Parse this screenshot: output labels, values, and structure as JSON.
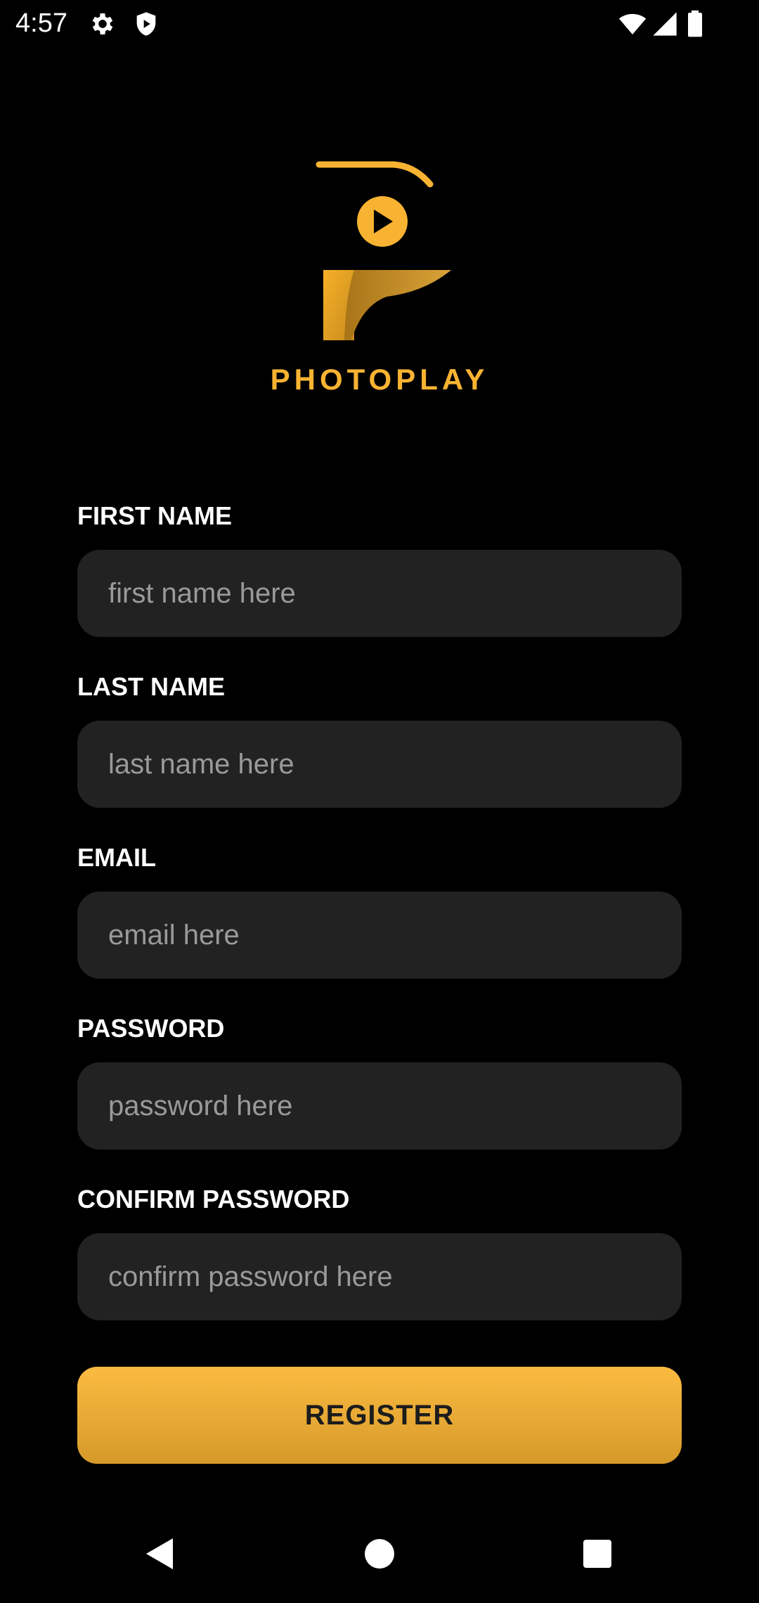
{
  "status_bar": {
    "time": "4:57",
    "icons_left": [
      "gear-icon",
      "shield-icon"
    ],
    "icons_right": [
      "wifi-icon",
      "cellular-signal-icon",
      "battery-icon"
    ]
  },
  "brand": {
    "name": "PHOTOPLAY",
    "color": "#F8B332"
  },
  "form": {
    "first_name": {
      "label": "FIRST NAME",
      "placeholder": "first name here",
      "value": ""
    },
    "last_name": {
      "label": "LAST NAME",
      "placeholder": "last name here",
      "value": ""
    },
    "email": {
      "label": "EMAIL",
      "placeholder": "email here",
      "value": ""
    },
    "password": {
      "label": "PASSWORD",
      "placeholder": "password here",
      "value": ""
    },
    "confirm_password": {
      "label": "CONFIRM PASSWORD",
      "placeholder": "confirm password here",
      "value": ""
    },
    "register_label": "REGISTER"
  },
  "navigation_bar": {
    "buttons": [
      "back-icon",
      "home-icon",
      "recents-icon"
    ]
  },
  "colors": {
    "background": "#000000",
    "input_background": "#222222",
    "accent": "#F8B332",
    "placeholder": "#9A9A9A",
    "label": "#FFFFFF"
  }
}
